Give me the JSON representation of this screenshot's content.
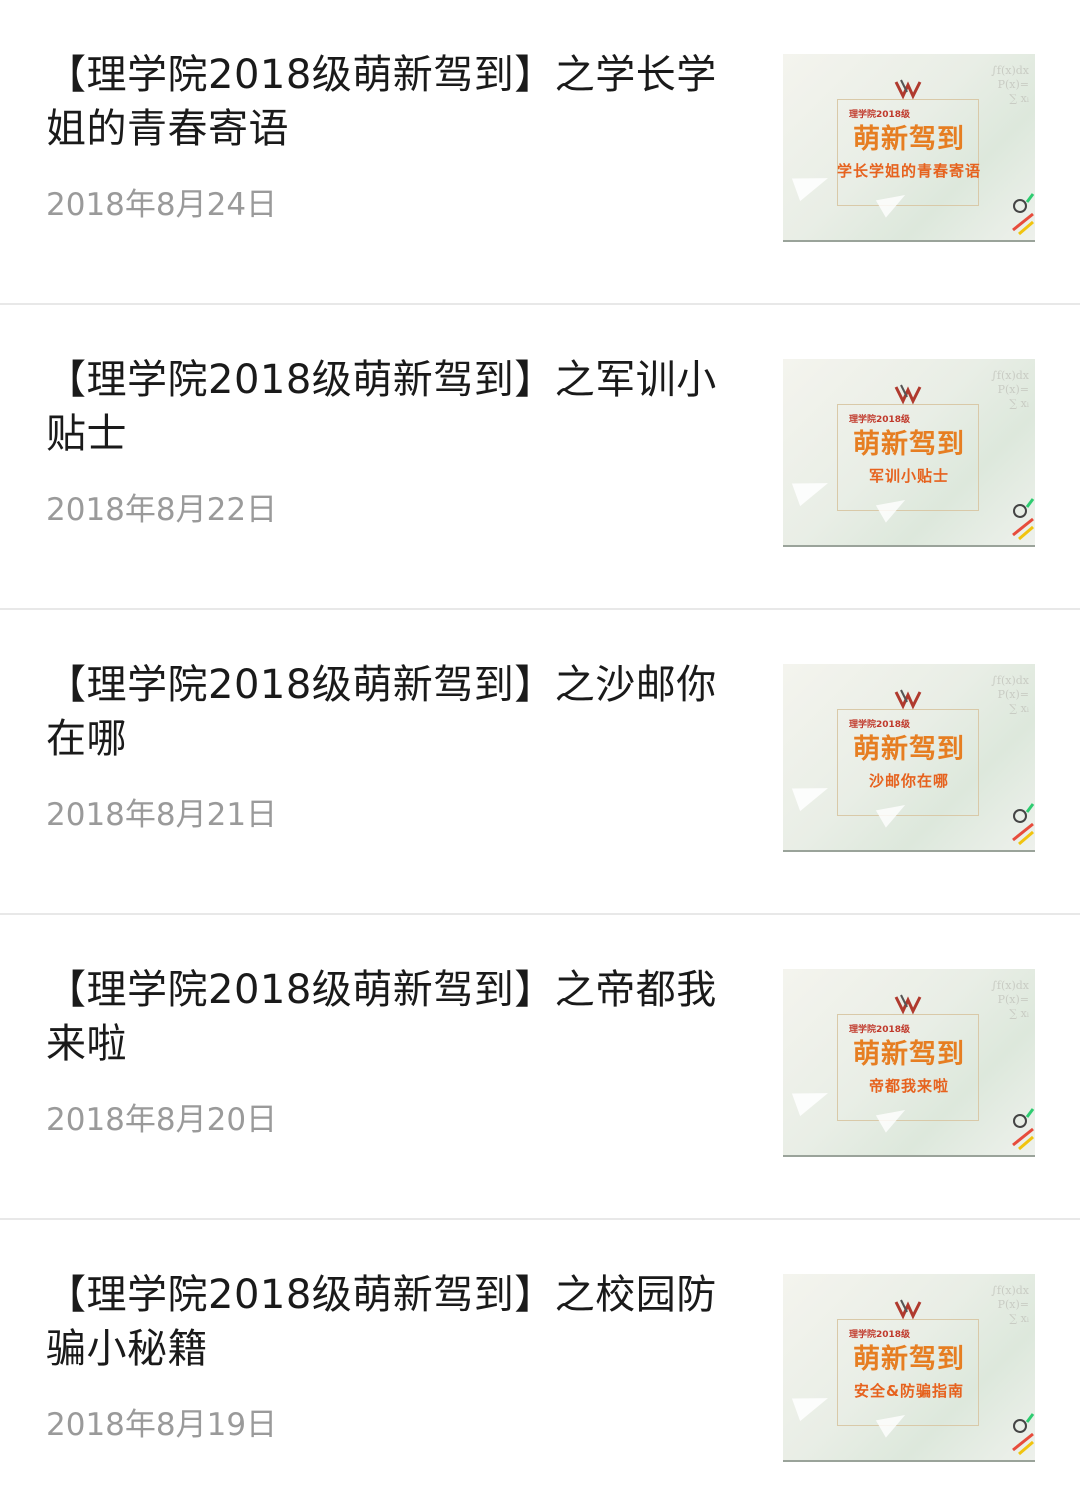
{
  "articles": [
    {
      "title": "【理学院2018级萌新驾到】之学长学姐的青春寄语",
      "date": "2018年8月24日",
      "thumb": {
        "small": "理学院2018级",
        "big": "萌新驾到",
        "sub": "学长学姐的青春寄语"
      }
    },
    {
      "title": "【理学院2018级萌新驾到】之军训小贴士",
      "date": "2018年8月22日",
      "thumb": {
        "small": "理学院2018级",
        "big": "萌新驾到",
        "sub": "军训小贴士"
      }
    },
    {
      "title": "【理学院2018级萌新驾到】之沙邮你在哪",
      "date": "2018年8月21日",
      "thumb": {
        "small": "理学院2018级",
        "big": "萌新驾到",
        "sub": "沙邮你在哪"
      }
    },
    {
      "title": "【理学院2018级萌新驾到】之帝都我来啦",
      "date": "2018年8月20日",
      "thumb": {
        "small": "理学院2018级",
        "big": "萌新驾到",
        "sub": "帝都我来啦"
      }
    },
    {
      "title": "【理学院2018级萌新驾到】之校园防骗小秘籍",
      "date": "2018年8月19日",
      "thumb": {
        "small": "理学院2018级",
        "big": "萌新驾到",
        "sub": "安全&防骗指南"
      }
    }
  ],
  "colors": {
    "title": "#1a1a1a",
    "date": "#9a9a9a",
    "divider": "#e8e8e8",
    "thumb_main": "#e67e22",
    "thumb_sub": "#e6621e"
  }
}
